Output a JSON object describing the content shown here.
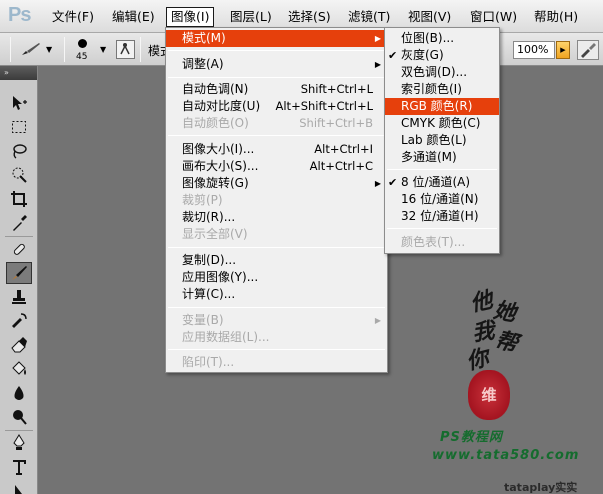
{
  "app": {
    "logo": "Ps"
  },
  "menubar": {
    "items": [
      {
        "label": "文件(F)"
      },
      {
        "label": "编辑(E)"
      },
      {
        "label": "图像(I)"
      },
      {
        "label": "图层(L)"
      },
      {
        "label": "选择(S)"
      },
      {
        "label": "滤镜(T)"
      },
      {
        "label": "视图(V)"
      },
      {
        "label": "窗口(W)"
      },
      {
        "label": "帮助(H)"
      }
    ],
    "active_index": 2
  },
  "options_bar": {
    "brush_size": "45",
    "mode_label": "模式",
    "zoom": "100%"
  },
  "image_menu": {
    "items": [
      {
        "label": "模式(M)",
        "shortcut": "",
        "submenu": true,
        "highlighted": true,
        "disabled": false
      },
      {
        "label": "调整(A)",
        "shortcut": "",
        "submenu": true,
        "disabled": false
      },
      {
        "label": "自动色调(N)",
        "shortcut": "Shift+Ctrl+L",
        "disabled": false
      },
      {
        "label": "自动对比度(U)",
        "shortcut": "Alt+Shift+Ctrl+L",
        "disabled": false
      },
      {
        "label": "自动颜色(O)",
        "shortcut": "Shift+Ctrl+B",
        "disabled": true
      },
      {
        "label": "图像大小(I)...",
        "shortcut": "Alt+Ctrl+I",
        "disabled": false
      },
      {
        "label": "画布大小(S)...",
        "shortcut": "Alt+Ctrl+C",
        "disabled": false
      },
      {
        "label": "图像旋转(G)",
        "shortcut": "",
        "submenu": true,
        "disabled": false
      },
      {
        "label": "裁剪(P)",
        "shortcut": "",
        "disabled": true
      },
      {
        "label": "裁切(R)...",
        "shortcut": "",
        "disabled": false
      },
      {
        "label": "显示全部(V)",
        "shortcut": "",
        "disabled": true
      },
      {
        "label": "复制(D)...",
        "shortcut": "",
        "disabled": false
      },
      {
        "label": "应用图像(Y)...",
        "shortcut": "",
        "disabled": false
      },
      {
        "label": "计算(C)...",
        "shortcut": "",
        "disabled": false
      },
      {
        "label": "变量(B)",
        "shortcut": "",
        "submenu": true,
        "disabled": true
      },
      {
        "label": "应用数据组(L)...",
        "shortcut": "",
        "disabled": true
      },
      {
        "label": "陷印(T)...",
        "shortcut": "",
        "disabled": true
      }
    ]
  },
  "mode_submenu": {
    "items": [
      {
        "label": "位图(B)...",
        "checked": false,
        "disabled": false
      },
      {
        "label": "灰度(G)",
        "checked": true,
        "disabled": false
      },
      {
        "label": "双色调(D)...",
        "checked": false,
        "disabled": false
      },
      {
        "label": "索引颜色(I)",
        "checked": false,
        "disabled": false
      },
      {
        "label": "RGB 颜色(R)",
        "checked": false,
        "disabled": false,
        "highlighted": true
      },
      {
        "label": "CMYK 颜色(C)",
        "checked": false,
        "disabled": false
      },
      {
        "label": "Lab 颜色(L)",
        "checked": false,
        "disabled": false
      },
      {
        "label": "多通道(M)",
        "checked": false,
        "disabled": false
      },
      {
        "label": "8 位/通道(A)",
        "checked": true,
        "disabled": false
      },
      {
        "label": "16 位/通道(N)",
        "checked": false,
        "disabled": false
      },
      {
        "label": "32 位/通道(H)",
        "checked": false,
        "disabled": false
      },
      {
        "label": "颜色表(T)...",
        "checked": false,
        "disabled": true
      }
    ]
  },
  "watermark": {
    "chars": [
      "他",
      "她",
      "我",
      "帮",
      "你"
    ],
    "seal": "维",
    "site_title": "PS教程网",
    "site_url": "www.tata580.com",
    "corner": "tataplay实实"
  },
  "colors": {
    "highlight": "#e6400c",
    "canvas": "#737373"
  }
}
